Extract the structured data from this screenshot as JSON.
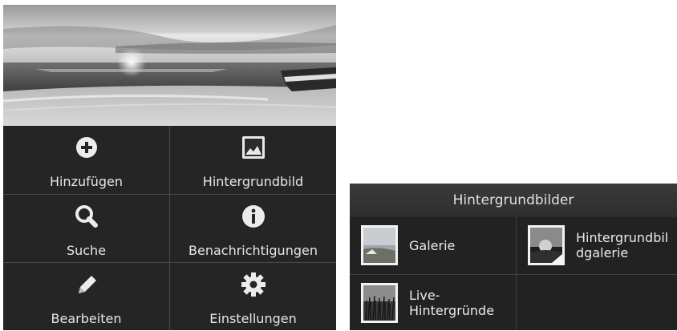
{
  "home_menu": {
    "items": [
      {
        "label": "Hinzufügen",
        "icon": "plus-circle-icon"
      },
      {
        "label": "Hintergrundbild",
        "icon": "picture-icon"
      },
      {
        "label": "Suche",
        "icon": "search-icon"
      },
      {
        "label": "Benachrichtigungen",
        "icon": "info-icon"
      },
      {
        "label": "Bearbeiten",
        "icon": "pencil-icon"
      },
      {
        "label": "Einstellungen",
        "icon": "gear-icon"
      }
    ]
  },
  "wallpaper_dialog": {
    "title": "Hintergrundbilder",
    "options": [
      {
        "label": "Galerie",
        "icon": "gallery-thumbnail"
      },
      {
        "label": "Hintergrundbil\ndgalerie",
        "icon": "wallpaper-gallery-thumbnail"
      },
      {
        "label": "Live-\nHintergründe",
        "icon": "live-wallpaper-thumbnail"
      }
    ]
  },
  "colors": {
    "menu_background": "#252525",
    "divider": "#4a4a4a",
    "text": "#e6e6e6"
  }
}
